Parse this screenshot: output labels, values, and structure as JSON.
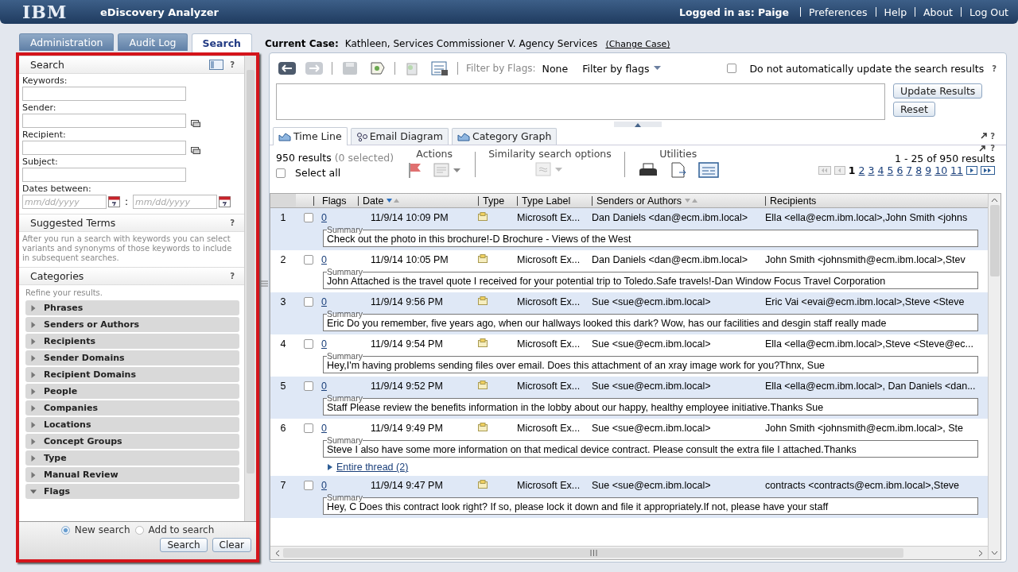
{
  "header": {
    "logo": "IBM",
    "title": "eDiscovery Analyzer",
    "user": "Logged in as: Paige",
    "links": [
      "Preferences",
      "Help",
      "About",
      "Log Out"
    ]
  },
  "tabs": [
    {
      "label": "Administration",
      "selected": false
    },
    {
      "label": "Audit Log",
      "selected": false
    },
    {
      "label": "Search",
      "selected": true
    }
  ],
  "case": {
    "label": "Current Case:",
    "name": "Kathleen, Services Commissioner V. Agency Services",
    "link": "(Change Case)"
  },
  "search_panel": {
    "title": "Search",
    "help": "?",
    "fields": [
      {
        "label": "Keywords:",
        "picker": false
      },
      {
        "label": "Sender:",
        "picker": true
      },
      {
        "label": "Recipient:",
        "picker": true
      },
      {
        "label": "Subject:",
        "picker": false
      }
    ],
    "dates": {
      "label": "Dates between:",
      "from_placeholder": "mm/dd/yyyy",
      "separator": ":",
      "to_placeholder": "mm/dd/yyyy"
    }
  },
  "suggested_terms": {
    "title": "Suggested Terms",
    "help": "?",
    "text": "After you run a search with keywords you can select variants and synonyms of those keywords to include in subsequent searches."
  },
  "categories": {
    "title": "Categories",
    "help": "?",
    "hint": "Refine your results.",
    "items": [
      {
        "label": "Phrases",
        "expanded": false
      },
      {
        "label": "Senders or Authors",
        "expanded": false
      },
      {
        "label": "Recipients",
        "expanded": false
      },
      {
        "label": "Sender Domains",
        "expanded": false
      },
      {
        "label": "Recipient Domains",
        "expanded": false
      },
      {
        "label": "People",
        "expanded": false
      },
      {
        "label": "Companies",
        "expanded": false
      },
      {
        "label": "Locations",
        "expanded": false
      },
      {
        "label": "Concept Groups",
        "expanded": false
      },
      {
        "label": "Type",
        "expanded": false
      },
      {
        "label": "Manual Review",
        "expanded": false
      },
      {
        "label": "Flags",
        "expanded": true
      }
    ]
  },
  "search_mode": [
    {
      "label": "New search",
      "selected": true
    },
    {
      "label": "Add to search",
      "selected": false
    }
  ],
  "panel_buttons": [
    "Search",
    "Clear"
  ],
  "toolbar": {
    "filter_label": "Filter by Flags:",
    "filter_value": "None",
    "filter_menu": "Filter by flags",
    "auto_update": {
      "label": "Do not automatically update the search results",
      "checked": false
    },
    "help": "?"
  },
  "query_buttons": [
    "Update Results",
    "Reset"
  ],
  "view_tabs": [
    {
      "label": "Time Line",
      "selected": true
    },
    {
      "label": "Email Diagram",
      "selected": false
    },
    {
      "label": "Category Graph",
      "selected": false
    }
  ],
  "view_help": "?",
  "results": {
    "count": "950 results",
    "selected_count": "(0 selected)",
    "select_all": "Select all",
    "select_all_checked": false,
    "groups": [
      "Actions",
      "Similarity search options",
      "Utilities"
    ],
    "help": "?",
    "range": "1 - 25 of 950 results",
    "pages": [
      {
        "label": "1",
        "selected": true
      },
      {
        "label": "2",
        "selected": false
      },
      {
        "label": "3",
        "selected": false
      },
      {
        "label": "4",
        "selected": false
      },
      {
        "label": "5",
        "selected": false
      },
      {
        "label": "6",
        "selected": false
      },
      {
        "label": "7",
        "selected": false
      },
      {
        "label": "8",
        "selected": false
      },
      {
        "label": "9",
        "selected": false
      },
      {
        "label": "10",
        "selected": false
      },
      {
        "label": "11",
        "selected": false
      }
    ]
  },
  "table": {
    "columns": [
      {
        "label": "Flags",
        "sortable": false,
        "sorted": false
      },
      {
        "label": "Date",
        "sortable": true,
        "sorted": true
      },
      {
        "label": "Type",
        "sortable": false,
        "sorted": false
      },
      {
        "label": "Type Label",
        "sortable": false,
        "sorted": false
      },
      {
        "label": "Senders or Authors",
        "sortable": true,
        "sorted": false
      },
      {
        "label": "Recipients",
        "sortable": false,
        "sorted": false
      }
    ],
    "rows": [
      {
        "number": "1",
        "checked": false,
        "flags": "0",
        "date": "11/9/14 10:09 PM",
        "type_label": "Microsoft Ex...",
        "sender": "Dan Daniels <dan@ecm.ibm.local>",
        "recipients": "Ella <ella@ecm.ibm.local>,John Smith <johns",
        "summary_label": "Summary",
        "summary": "Check out the photo in this brochure!-D Brochure - Views of the West"
      },
      {
        "number": "2",
        "checked": false,
        "flags": "0",
        "date": "11/9/14 10:05 PM",
        "type_label": "Microsoft Ex...",
        "sender": "Dan Daniels <dan@ecm.ibm.local>",
        "recipients": "John Smith <johnsmith@ecm.ibm.local>,Stev",
        "summary_label": "Summary",
        "summary": "John Attached is the travel quote I received for your potential trip to Toledo.Safe travels!-Dan Window Focus Travel Corporation"
      },
      {
        "number": "3",
        "checked": false,
        "flags": "0",
        "date": "11/9/14 9:56 PM",
        "type_label": "Microsoft Ex...",
        "sender": "Sue <sue@ecm.ibm.local>",
        "recipients": "Eric Vai <evai@ecm.ibm.local>,Steve <Steve",
        "summary_label": "Summary",
        "summary": "Eric Do you remember, five years ago, when our hallways looked this dark? Wow, has our facilities and desgin staff really made"
      },
      {
        "number": "4",
        "checked": false,
        "flags": "0",
        "date": "11/9/14 9:54 PM",
        "type_label": "Microsoft Ex...",
        "sender": "Sue <sue@ecm.ibm.local>",
        "recipients": "Ella <ella@ecm.ibm.local>,Steve <Steve@ec...",
        "summary_label": "Summary",
        "summary": "Hey,I'm having problems sending files over email. Does this attachment of an xray image work for you?Thnx, Sue"
      },
      {
        "number": "5",
        "checked": false,
        "flags": "0",
        "date": "11/9/14 9:52 PM",
        "type_label": "Microsoft Ex...",
        "sender": "Sue <sue@ecm.ibm.local>",
        "recipients": "Ella <ella@ecm.ibm.local>, Dan Daniels <dan...",
        "summary_label": "Summary",
        "summary": "Staff Please review the benefits information in the lobby about our happy, healthy employee initiative.Thanks Sue"
      },
      {
        "number": "6",
        "checked": false,
        "flags": "0",
        "date": "11/9/14 9:49 PM",
        "type_label": "Microsoft Ex...",
        "sender": "Sue <sue@ecm.ibm.local>",
        "recipients": "John Smith <johnsmith@ecm.ibm.local>, Ste",
        "summary_label": "Summary",
        "summary": "Steve I also have some more information on that medical device contract. Please consult the extra file I attached.Thanks",
        "thread": "Entire thread (2)"
      },
      {
        "number": "7",
        "checked": false,
        "flags": "0",
        "date": "11/9/14 9:47 PM",
        "type_label": "Microsoft Ex...",
        "sender": "Sue <sue@ecm.ibm.local>",
        "recipients": "contracts <contracts@ecm.ibm.local>,Steve",
        "summary_label": "Summary",
        "summary": "Hey, C Does this contract look right? If so, please lock it down and file it appropriately.If not, please have your staff"
      }
    ]
  }
}
